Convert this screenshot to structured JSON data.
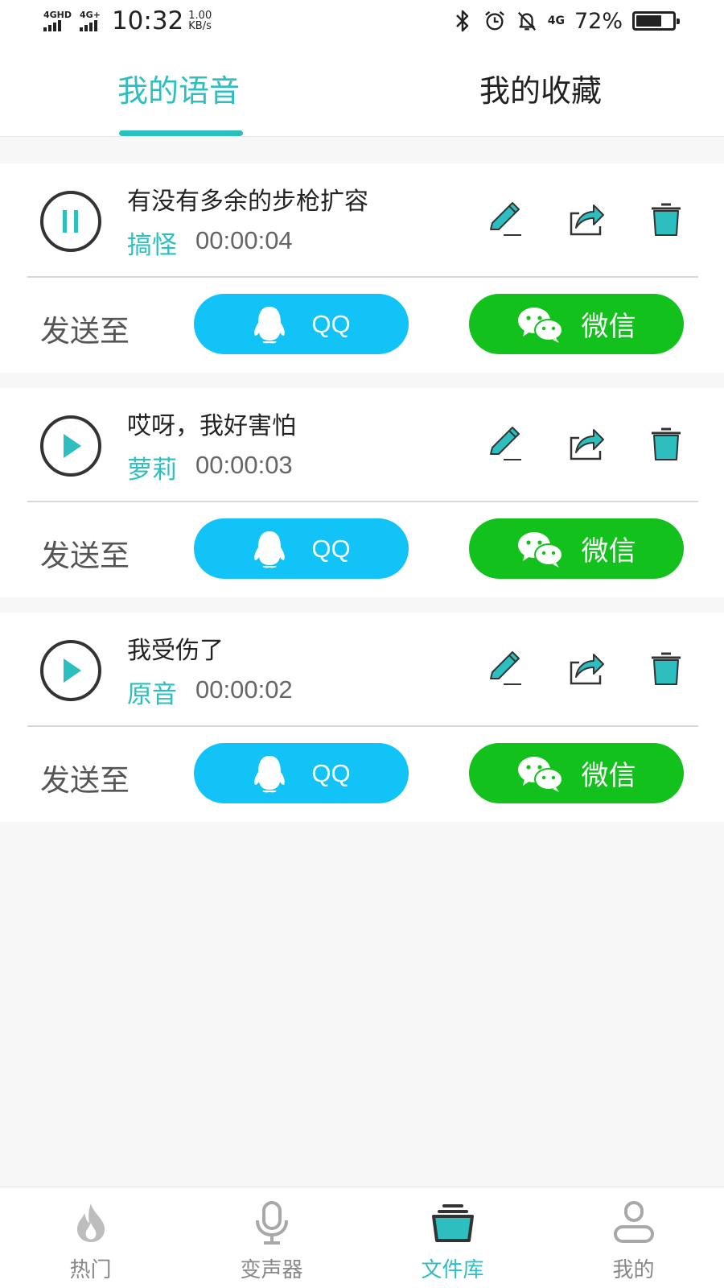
{
  "status_bar": {
    "network1": "4GHD",
    "network2": "4G+",
    "time": "10:32",
    "speed_value": "1.00",
    "speed_unit": "KB/s",
    "signal_type": "4G",
    "battery_percent": "72%",
    "battery_level": 0.72
  },
  "tabs": {
    "active": "我的语音",
    "items": [
      {
        "label": "我的语音"
      },
      {
        "label": "我的收藏"
      }
    ]
  },
  "recordings": [
    {
      "title": "有没有多余的步枪扩容",
      "voice": "搞怪",
      "duration": "00:00:04",
      "state": "pause-icon",
      "send_label": "发送至",
      "qq_label": "QQ",
      "wechat_label": "微信"
    },
    {
      "title": "哎呀，我好害怕",
      "voice": "萝莉",
      "duration": "00:00:03",
      "state": "play-icon",
      "send_label": "发送至",
      "qq_label": "QQ",
      "wechat_label": "微信"
    },
    {
      "title": "我受伤了",
      "voice": "原音",
      "duration": "00:00:02",
      "state": "play-icon",
      "send_label": "发送至",
      "qq_label": "QQ",
      "wechat_label": "微信"
    }
  ],
  "bottom_nav": {
    "active": "文件库",
    "items": [
      {
        "label": "热门",
        "icon": "flame-icon"
      },
      {
        "label": "变声器",
        "icon": "microphone-icon"
      },
      {
        "label": "文件库",
        "icon": "library-icon"
      },
      {
        "label": "我的",
        "icon": "user-icon"
      }
    ]
  },
  "colors": {
    "accent": "#2dbfbf",
    "qq": "#12c3f7",
    "wechat": "#12c11c",
    "text": "#222222",
    "muted": "#888888",
    "background": "#f7f7f7"
  }
}
